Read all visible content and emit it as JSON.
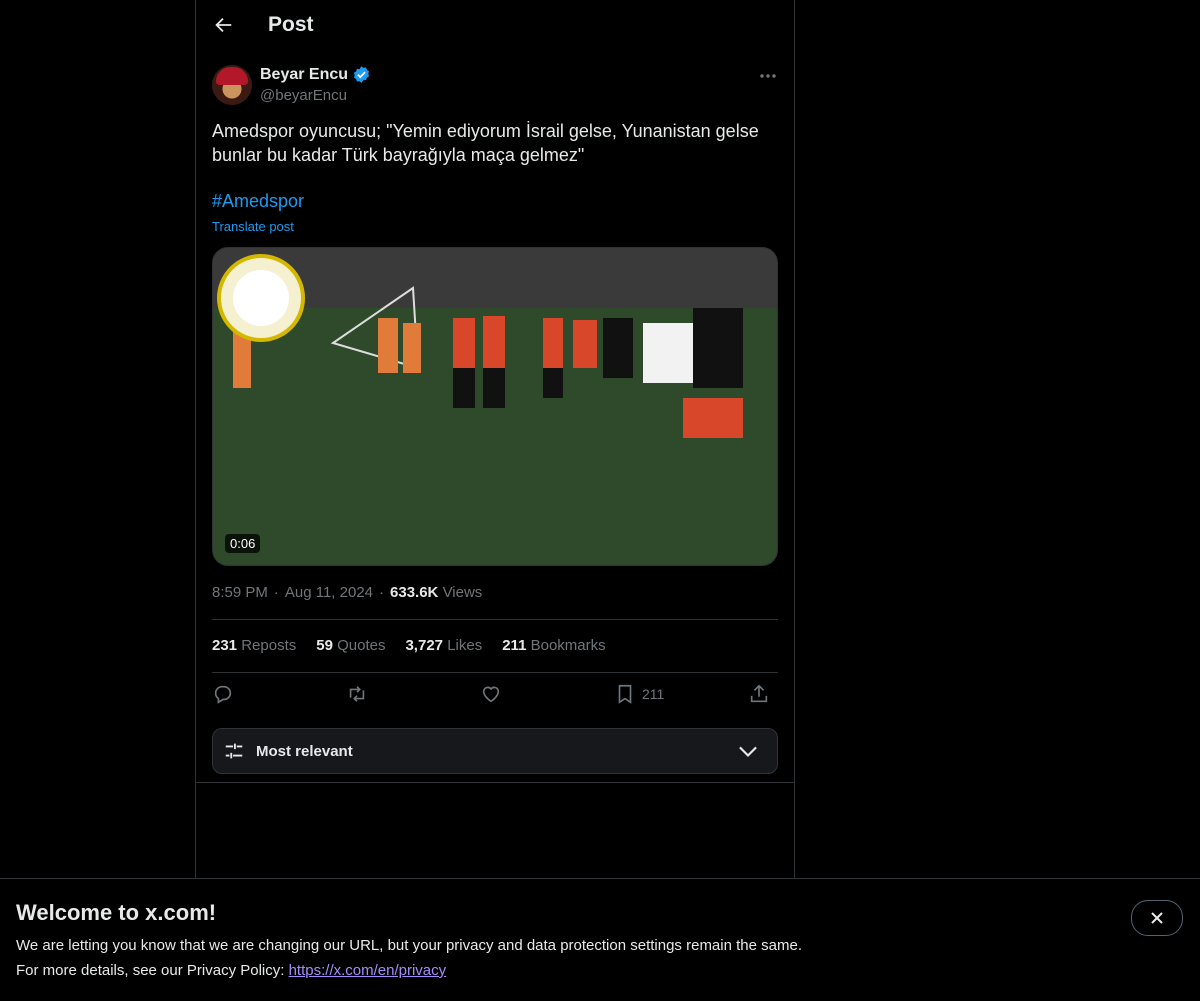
{
  "header": {
    "title": "Post"
  },
  "post": {
    "author_name": "Beyar Encu",
    "handle": "@beyarEncu",
    "text": "Amedspor oyuncusu; \"Yemin ediyorum İsrail gelse, Yunanistan gelse bunlar bu kadar Türk bayrağıyla maça gelmez\"",
    "hashtag": "#Amedspor",
    "translate_label": "Translate post",
    "video_duration": "0:06",
    "time": "8:59 PM",
    "date": "Aug 11, 2024",
    "views_count": "633.6K",
    "views_label": "Views",
    "sep": "·"
  },
  "stats": [
    {
      "count": "231",
      "label": "Reposts"
    },
    {
      "count": "59",
      "label": "Quotes"
    },
    {
      "count": "3,727",
      "label": "Likes"
    },
    {
      "count": "211",
      "label": "Bookmarks"
    }
  ],
  "actions": {
    "bookmark_count": "211"
  },
  "sort": {
    "label": "Most relevant"
  },
  "banner": {
    "title": "Welcome to x.com!",
    "line1": "We are letting you know that we are changing our URL, but your privacy and data protection settings remain the same.",
    "line2_prefix": "For more details, see our Privacy Policy: ",
    "link": "https://x.com/en/privacy"
  },
  "colors": {
    "accent": "#1d9bf0",
    "background": "#000000",
    "link_visited": "#a78bfa"
  }
}
